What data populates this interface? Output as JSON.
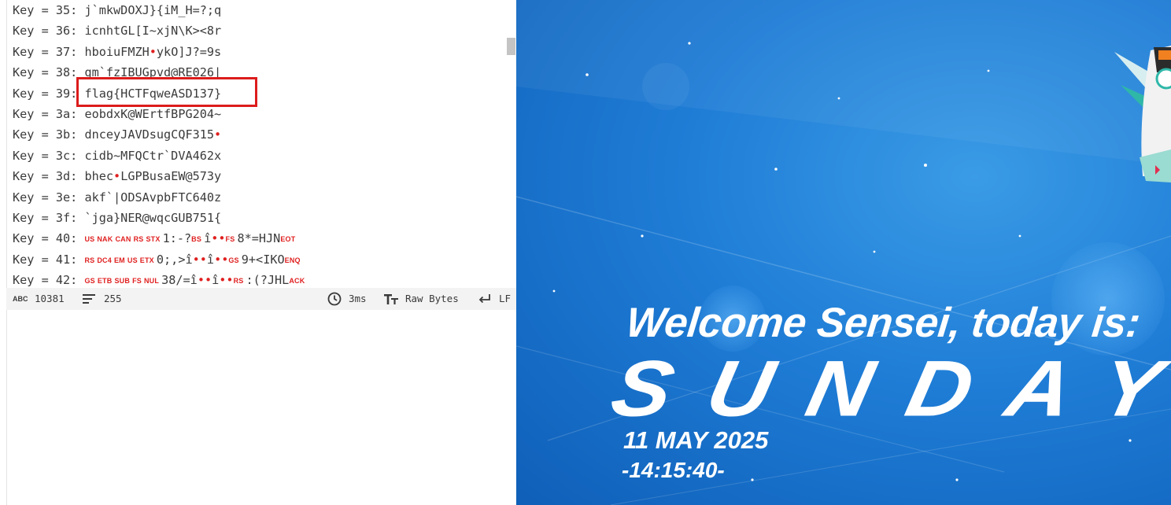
{
  "output": {
    "lines": [
      {
        "key": "Key = 35:",
        "parts": [
          {
            "t": "j`mkwDOXJ}{iM_H=?;q"
          }
        ]
      },
      {
        "key": "Key = 36:",
        "parts": [
          {
            "t": "icnhtGL[I~xjN\\K><8r"
          }
        ]
      },
      {
        "key": "Key = 37:",
        "parts": [
          {
            "t": "hboiuFMZH"
          },
          {
            "dot": "•"
          },
          {
            "t": "ykO]J?=9s"
          }
        ]
      },
      {
        "key": "Key = 38:",
        "parts": [
          {
            "t": "gm`fzIBUGpvd@RE026|"
          }
        ]
      },
      {
        "key": "Key = 39:",
        "parts": [
          {
            "t": "flag{HCTFqweASD137}"
          }
        ]
      },
      {
        "key": "Key = 3a:",
        "parts": [
          {
            "t": "eobdxK@WErtfBPG204~"
          }
        ]
      },
      {
        "key": "Key = 3b:",
        "parts": [
          {
            "t": "dnceyJAVDsugCQF315"
          },
          {
            "dot": "•"
          }
        ]
      },
      {
        "key": "Key = 3c:",
        "parts": [
          {
            "t": "cidb~MFQCtr`DVA462x"
          }
        ]
      },
      {
        "key": "Key = 3d:",
        "parts": [
          {
            "t": "bhec"
          },
          {
            "dot": "•"
          },
          {
            "t": "LGPBusaEW@573y"
          }
        ]
      },
      {
        "key": "Key = 3e:",
        "parts": [
          {
            "t": "akf`|ODSAvpbFTC640z"
          }
        ]
      },
      {
        "key": "Key = 3f:",
        "parts": [
          {
            "t": "`jga}NER@wqcGUB751{"
          }
        ]
      },
      {
        "key": "Key = 40:",
        "parts": [
          {
            "c": "US"
          },
          {
            "c": "NAK"
          },
          {
            "c": "CAN"
          },
          {
            "c": "RS"
          },
          {
            "c": "STX"
          },
          {
            "t": "1:-?"
          },
          {
            "c": "BS"
          },
          {
            "t": "î"
          },
          {
            "dot": "••"
          },
          {
            "c": "FS"
          },
          {
            "t": "8*=HJN"
          },
          {
            "c": "EOT"
          }
        ]
      },
      {
        "key": "Key = 41:",
        "parts": [
          {
            "c": "RS"
          },
          {
            "c": "DC4"
          },
          {
            "c": "EM"
          },
          {
            "c": "US"
          },
          {
            "c": "ETX"
          },
          {
            "t": "0;,>î"
          },
          {
            "dot": "••"
          },
          {
            "t": "î"
          },
          {
            "dot": "••"
          },
          {
            "c": "GS"
          },
          {
            "t": "9+<IKO"
          },
          {
            "c": "ENQ"
          }
        ]
      },
      {
        "key": "Key = 42:",
        "parts": [
          {
            "c": "GS"
          },
          {
            "c": "ETB"
          },
          {
            "c": "SUB"
          },
          {
            "c": "FS"
          },
          {
            "c": "NUL"
          },
          {
            "t": "38/=î"
          },
          {
            "dot": "••"
          },
          {
            "t": "î"
          },
          {
            "dot": "••"
          },
          {
            "c": "RS"
          },
          {
            "t": ":(?JHL"
          },
          {
            "c": "ACK"
          }
        ]
      }
    ]
  },
  "statusbar": {
    "length_icon_text": "ABC",
    "length": "10381",
    "lines": "255",
    "time": "3ms",
    "encoding": "Raw Bytes",
    "eol": "LF"
  },
  "wallpaper": {
    "greeting": "Welcome Sensei, today is:",
    "day": "SUNDAY",
    "date": "11 MAY 2025",
    "time": "-14:15:40-"
  },
  "icons": {
    "length": "abc-icon",
    "lines": "lines-icon",
    "time": "clock-icon",
    "encoding": "text-size-icon",
    "eol": "return-arrow-icon"
  },
  "colors": {
    "highlight": "#dc1c1c",
    "control_char": "#e02020",
    "wallpaper_blue": "#1f7dd6"
  }
}
